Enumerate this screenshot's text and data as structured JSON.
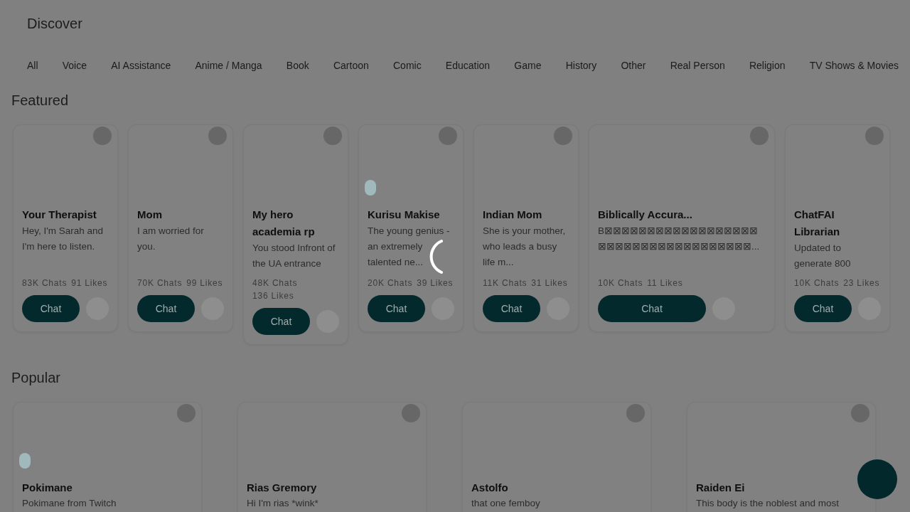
{
  "page": {
    "title": "Discover",
    "loading": true
  },
  "categories": [
    "All",
    "Voice",
    "AI Assistance",
    "Anime / Manga",
    "Book",
    "Cartoon",
    "Comic",
    "Education",
    "Game",
    "History",
    "Other",
    "Real Person",
    "Religion",
    "TV Shows & Movies"
  ],
  "sections": [
    {
      "title": "Featured",
      "kind": "featured",
      "cards": [
        {
          "name": "Your Therapist",
          "description": "Hey, I'm Sarah and I'm here to listen.",
          "chats": "83K Chats",
          "likes": "91 Likes",
          "button": "Chat",
          "badge": false
        },
        {
          "name": "Mom",
          "description": "I am worried for you.",
          "chats": "70K Chats",
          "likes": "99 Likes",
          "button": "Chat",
          "badge": false
        },
        {
          "name": "My hero academia rp",
          "description": "You stood Infront of the UA entrance",
          "chats": "48K Chats",
          "likes": "136 Likes",
          "button": "Chat",
          "badge": false
        },
        {
          "name": "Kurisu Makise",
          "description": "The young genius - an extremely talented ne...",
          "chats": "20K Chats",
          "likes": "39 Likes",
          "button": "Chat",
          "badge": true
        },
        {
          "name": "Indian Mom",
          "description": "She is your mother, who leads a busy life m...",
          "chats": "11K Chats",
          "likes": "31 Likes",
          "button": "Chat",
          "badge": false
        },
        {
          "name": "Biblically Accura...",
          "description": "B⊠⊠⊠⊠⊠⊠⊠⊠⊠⊠⊠⊠⊠⊠⊠⊠⊠⊠⊠⊠⊠⊠⊠⊠⊠⊠⊠⊠⊠⊠⊠⊠⊠⊠⊠⊠...",
          "chats": "10K Chats",
          "likes": "11 Likes",
          "button": "Chat",
          "badge": false
        },
        {
          "name": "ChatFAI Librarian",
          "description": "Updated to generate 800",
          "chats": "10K Chats",
          "likes": "23 Likes",
          "button": "Chat",
          "badge": false
        }
      ]
    },
    {
      "title": "Popular",
      "kind": "popular",
      "cards": [
        {
          "name": "Pokimane",
          "description": "Pokimane from Twitch",
          "badge": true
        },
        {
          "name": "Rias Gremory",
          "description": "Hi I'm rias *wink*",
          "badge": false
        },
        {
          "name": "Astolfo",
          "description": "that one femboy",
          "badge": false
        },
        {
          "name": "Raiden Ei",
          "description": "This body is the noblest and most",
          "badge": false
        }
      ]
    }
  ]
}
